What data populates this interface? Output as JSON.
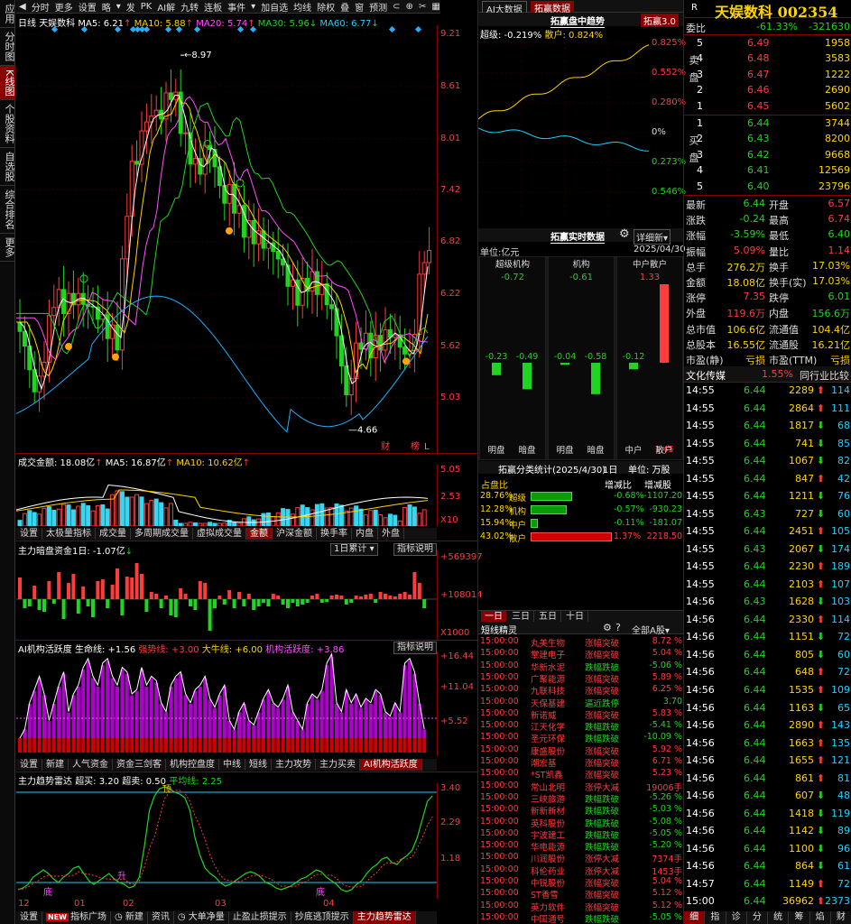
{
  "left_sidebar": [
    "应用",
    "分时图",
    "K线图",
    "个股资料",
    "自选股",
    "综合排名",
    "更多"
  ],
  "toolbar": {
    "items": [
      "分时",
      "更多",
      "设置",
      "略",
      "发",
      "PK",
      "AI解",
      "九转",
      "连板",
      "事件",
      "加自选",
      "均线",
      "除权",
      "叠",
      "窗",
      "预测",
      "更多"
    ],
    "icons": [
      "arrow-left-icon",
      "dropdown-icon",
      "magnet-icon",
      "zoom-icon",
      "cut-icon",
      "grid-icon",
      "menu-icon"
    ]
  },
  "kline": {
    "label": "日线",
    "name": "天娱数科",
    "ma5": "MA5: 6.21",
    "ma10": "MA10: 5.88",
    "ma20": "MA20: 5.74",
    "ma30": "MA30: 5.96",
    "ma60": "MA60: 6.77",
    "high_label": "8.97",
    "low_label": "4.66",
    "y_ticks": [
      "9.21",
      "8.61",
      "8.01",
      "7.42",
      "6.82",
      "6.22",
      "5.62",
      "5.03"
    ],
    "markers": [
      "财",
      "榜",
      "L"
    ],
    "colors": {
      "up": "#ff3c3c",
      "down": "#21d421",
      "ma5": "#ffffff",
      "ma10": "#ffd400",
      "ma20": "#ff4fff",
      "ma30": "#21d421",
      "ma60": "#1fb0ff"
    }
  },
  "volume": {
    "title": "成交金额: 18.08亿",
    "ma5": "MA5: 16.87亿",
    "ma10": "MA10: 10.62亿",
    "y_ticks": [
      "5.05",
      "2.53",
      "X10"
    ],
    "tabs": [
      "设置",
      "太极量指标",
      "成交量",
      "多周期成交量",
      "虚拟成交量",
      "金额",
      "沪深金额",
      "换手率",
      "内盘",
      "外盘"
    ],
    "active_tab": "金额"
  },
  "capital": {
    "title": "主力暗盘资金1日: -1.07亿",
    "dropdown": "1日累计",
    "help": "指标说明",
    "y_ticks": [
      "+569397",
      "+108014",
      "X1000"
    ]
  },
  "ai": {
    "title": "AI机构活跃度",
    "life": "生命线: +1.56",
    "strong": "强势线: +3.00",
    "bull": "大牛线: +6.00",
    "active": "机构活跃度: +3.86",
    "help": "指标说明",
    "y_ticks": [
      "+16.44",
      "+11.04",
      "+5.52"
    ],
    "tabs": [
      "设置",
      "新建",
      "人气资金",
      "资金三剑客",
      "机构控盘度",
      "中线",
      "短线",
      "主力攻势",
      "主力买卖",
      "AI机构活跃度"
    ],
    "active_tab": "AI机构活跃度"
  },
  "radar": {
    "title": "主力趋势雷达",
    "overbuy": "超买: 3.20",
    "oversell": "超卖: 0.50",
    "avg": "平均线: 2.25",
    "y_ticks": [
      "3.40",
      "2.29",
      "1.18"
    ],
    "x_ticks": [
      "12",
      "01",
      "02",
      "03",
      "04"
    ],
    "markers": [
      "底",
      "升",
      "顶",
      "底"
    ]
  },
  "bottom_tabs": [
    "设置",
    "指标广场",
    "新建",
    "资讯",
    "大单净量",
    "止盈止损提示",
    "抄底逃顶提示",
    "主力趋势雷达"
  ],
  "bottom_active": "主力趋势雷达",
  "bottom_new_badge": "NEW",
  "intraday": {
    "tab_ai": "AI大数据",
    "tab_tuo": "拓赢数据",
    "title": "拓赢盘中趋势",
    "btn": "拓赢3.0",
    "super": "超级: -0.219%",
    "retail": "散户: 0.824%",
    "y_ticks": [
      "0.825%",
      "0.552%",
      "0.280%",
      "0%",
      "0.273%",
      "0.546%"
    ]
  },
  "realtime": {
    "title": "拓赢实时数据",
    "detail": "详细新",
    "unit": "单位:亿元",
    "date": "2025/04/30",
    "groups": [
      {
        "name": "超级机构",
        "total": "-0.72",
        "bars": [
          {
            "label": "明盘",
            "v": -0.23
          },
          {
            "label": "暗盘",
            "v": -0.49
          }
        ]
      },
      {
        "name": "机构",
        "total": "-0.61",
        "bars": [
          {
            "label": "明盘",
            "v": -0.04
          },
          {
            "label": "暗盘",
            "v": -0.58
          }
        ]
      },
      {
        "name": "中户散户",
        "total": "1.33",
        "bars": [
          {
            "label": "中户",
            "v": -0.12
          },
          {
            "label": "散户",
            "v": 1.45
          }
        ]
      }
    ]
  },
  "stats": {
    "title": "拓赢分类统计(2025/4/30)",
    "period": "1日",
    "unit": "单位: 万股",
    "headers": [
      "占盘比",
      "增减比",
      "增减股"
    ],
    "rows": [
      {
        "pct": "28.76%",
        "name": "超级",
        "ratio": "-0.68%",
        "shares": "-1107.20"
      },
      {
        "pct": "12.28%",
        "name": "机构",
        "ratio": "-0.57%",
        "shares": "-930.23"
      },
      {
        "pct": "15.94%",
        "name": "中户",
        "ratio": "-0.11%",
        "shares": "-181.07"
      },
      {
        "pct": "43.02%",
        "name": "散户",
        "ratio": "1.37%",
        "shares": "2218.50"
      }
    ]
  },
  "sprite": {
    "periods": [
      "一日",
      "三日",
      "五日",
      "十日"
    ],
    "active_period": "一日",
    "title": "短线精灵",
    "filter": "全部A股",
    "rows": [
      [
        "15:00:00",
        "丸美生物",
        "涨幅突破",
        "8.72 %"
      ],
      [
        "15:00:00",
        "掌建电子",
        "涨幅突破",
        "5.04 %"
      ],
      [
        "15:00:00",
        "华新水泥",
        "跌幅跌破",
        "-5.06 %"
      ],
      [
        "15:00:00",
        "广聚能源",
        "涨幅突破",
        "5.89 %"
      ],
      [
        "15:00:00",
        "九联科技",
        "涨幅突破",
        "6.25 %"
      ],
      [
        "15:00:00",
        "天保基建",
        "逼近跌停",
        "3.70"
      ],
      [
        "15:00:00",
        "新诺威",
        "涨幅突破",
        "5.83 %"
      ],
      [
        "15:00:00",
        "江天化学",
        "跌幅跌破",
        "-5.41 %"
      ],
      [
        "15:00:00",
        "圣元环保",
        "跌幅跌破",
        "-10.09 %"
      ],
      [
        "15:00:00",
        "康盛股份",
        "涨幅突破",
        "5.92 %"
      ],
      [
        "15:00:00",
        "潮宏基",
        "涨幅突破",
        "6.71 %"
      ],
      [
        "15:00:00",
        "*ST凯鑫",
        "涨幅突破",
        "5.23 %"
      ],
      [
        "15:00:00",
        "常山北明",
        "涨停大减",
        "19006手"
      ],
      [
        "15:00:00",
        "三峡旅游",
        "跌幅跌破",
        "-5.26 %"
      ],
      [
        "15:00:00",
        "新新新材",
        "跌幅跌破",
        "-5.03 %"
      ],
      [
        "15:00:00",
        "英科股份",
        "跌幅跌破",
        "-5.08 %"
      ],
      [
        "15:00:00",
        "宇波建工",
        "跌幅跌破",
        "-5.05 %"
      ],
      [
        "15:00:00",
        "华电能源",
        "跌幅跌破",
        "-5.20 %"
      ],
      [
        "15:00:00",
        "川润股份",
        "涨停大减",
        "7374手"
      ],
      [
        "15:00:00",
        "科伦药业",
        "涨停大减",
        "1453手"
      ],
      [
        "15:00:00",
        "中锐股份",
        "涨幅突破",
        "5.04 %"
      ],
      [
        "15:00:00",
        "ST香雪",
        "涨幅突破",
        "5.12 %"
      ],
      [
        "15:00:00",
        "英力软件",
        "涨幅突破",
        "5.12 %"
      ],
      [
        "15:00:00",
        "中国通号",
        "跌幅跌破",
        "-5.05 %"
      ]
    ]
  },
  "quote": {
    "tag": "R",
    "name": "天娱数科 002354",
    "weibi_label": "委比",
    "weibi": "-61.33%",
    "weicha": "-321630",
    "sell_label": "卖盘",
    "buy_label": "买盘",
    "asks": [
      [
        "5",
        "6.49",
        "1958"
      ],
      [
        "4",
        "6.48",
        "3583"
      ],
      [
        "3",
        "6.47",
        "1222"
      ],
      [
        "2",
        "6.46",
        "2690"
      ],
      [
        "1",
        "6.45",
        "5602"
      ]
    ],
    "bids": [
      [
        "1",
        "6.44",
        "3744"
      ],
      [
        "2",
        "6.43",
        "8200"
      ],
      [
        "3",
        "6.42",
        "9668"
      ],
      [
        "4",
        "6.41",
        "12569"
      ],
      [
        "5",
        "6.40",
        "23796"
      ]
    ],
    "stats": [
      [
        "最新",
        "6.44",
        "开盘",
        "6.57"
      ],
      [
        "涨跌",
        "-0.24",
        "最高",
        "6.74"
      ],
      [
        "涨幅",
        "-3.59%",
        "最低",
        "6.40"
      ],
      [
        "振幅",
        "5.09%",
        "量比",
        "1.14"
      ],
      [
        "总手",
        "276.2万",
        "换手",
        "17.03%"
      ],
      [
        "金额",
        "18.08亿",
        "换手(实)",
        "17.03%"
      ],
      [
        "涨停",
        "7.35",
        "跌停",
        "6.01"
      ],
      [
        "外盘",
        "119.6万",
        "内盘",
        "156.6万"
      ],
      [
        "总市值",
        "106.6亿",
        "流通值",
        "104.4亿"
      ],
      [
        "总股本",
        "16.55亿",
        "流通股",
        "16.21亿"
      ],
      [
        "市盈(静)",
        "亏损",
        "市盈(TTM)",
        "亏损"
      ]
    ],
    "industry": "文化传媒",
    "industry_pct": "1.55%",
    "compare": "同行业比较",
    "ticks": [
      [
        "14:55",
        "6.44",
        "2289",
        "up",
        "114"
      ],
      [
        "14:55",
        "6.44",
        "2864",
        "up",
        "111"
      ],
      [
        "14:55",
        "6.44",
        "1817",
        "down",
        "68"
      ],
      [
        "14:55",
        "6.44",
        "741",
        "down",
        "85"
      ],
      [
        "14:55",
        "6.44",
        "1067",
        "down",
        "82"
      ],
      [
        "14:55",
        "6.44",
        "847",
        "up",
        "42"
      ],
      [
        "14:55",
        "6.44",
        "1211",
        "down",
        "76"
      ],
      [
        "14:55",
        "6.43",
        "727",
        "down",
        "60"
      ],
      [
        "14:55",
        "6.44",
        "2451",
        "up",
        "105"
      ],
      [
        "14:55",
        "6.43",
        "2067",
        "down",
        "174"
      ],
      [
        "14:55",
        "6.44",
        "2230",
        "up",
        "189"
      ],
      [
        "14:55",
        "6.44",
        "2103",
        "up",
        "107"
      ],
      [
        "14:56",
        "6.43",
        "1628",
        "down",
        "103"
      ],
      [
        "14:56",
        "6.44",
        "2330",
        "up",
        "114"
      ],
      [
        "14:56",
        "6.44",
        "1151",
        "down",
        "72"
      ],
      [
        "14:56",
        "6.44",
        "805",
        "down",
        "60"
      ],
      [
        "14:56",
        "6.44",
        "648",
        "up",
        "72"
      ],
      [
        "14:56",
        "6.44",
        "1535",
        "up",
        "109"
      ],
      [
        "14:56",
        "6.44",
        "1163",
        "down",
        "65"
      ],
      [
        "14:56",
        "6.44",
        "2890",
        "up",
        "143"
      ],
      [
        "14:56",
        "6.44",
        "1663",
        "up",
        "135"
      ],
      [
        "14:56",
        "6.44",
        "1655",
        "up",
        "121"
      ],
      [
        "14:56",
        "6.44",
        "861",
        "up",
        "81"
      ],
      [
        "14:56",
        "6.44",
        "607",
        "down",
        "48"
      ],
      [
        "14:56",
        "6.44",
        "1418",
        "down",
        "119"
      ],
      [
        "14:56",
        "6.44",
        "1142",
        "down",
        "89"
      ],
      [
        "14:56",
        "6.44",
        "1100",
        "down",
        "96"
      ],
      [
        "14:56",
        "6.44",
        "864",
        "down",
        "61"
      ],
      [
        "14:57",
        "6.44",
        "1149",
        "up",
        "72"
      ],
      [
        "15:00",
        "6.44",
        "36962",
        "up",
        "2373"
      ]
    ],
    "bottom_tabs": [
      "细",
      "指",
      "诊",
      "分",
      "统",
      "筹",
      "焰",
      "财"
    ],
    "bottom_active": "细"
  }
}
